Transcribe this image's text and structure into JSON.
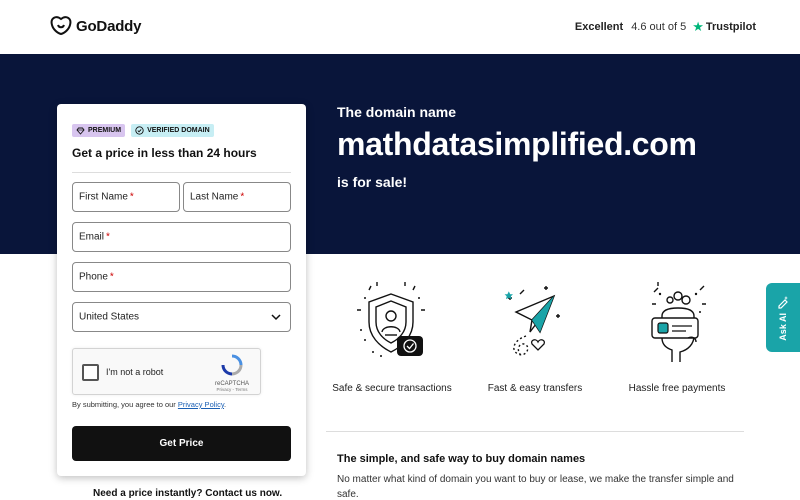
{
  "header": {
    "brand": "GoDaddy",
    "rating_label": "Excellent",
    "rating_score": "4.6 out of 5",
    "rating_source": "Trustpilot"
  },
  "hero": {
    "subtitle": "The domain name",
    "domain": "mathdatasimplified.com",
    "status": "is for sale!"
  },
  "form": {
    "badge_premium": "PREMIUM",
    "badge_verified": "VERIFIED DOMAIN",
    "title": "Get a price in less than 24 hours",
    "first_name_label": "First Name",
    "last_name_label": "Last Name",
    "email_label": "Email",
    "phone_label": "Phone",
    "required_mark": "*",
    "country_value": "United States",
    "captcha_label": "I'm not a robot",
    "captcha_brand": "reCAPTCHA",
    "captcha_links": "Privacy - Terms",
    "consent_text": "By submitting, you agree to our ",
    "consent_link": "Privacy Policy",
    "consent_end": ".",
    "submit_label": "Get Price"
  },
  "instant_price": "Need a price instantly? Contact us now.",
  "features": [
    {
      "label": "Safe & secure transactions",
      "icon": "shield-icon"
    },
    {
      "label": "Fast & easy transfers",
      "icon": "paper-plane-icon"
    },
    {
      "label": "Hassle free payments",
      "icon": "payment-card-icon"
    }
  ],
  "info": {
    "title": "The simple, and safe way to buy domain names",
    "body": "No matter what kind of domain you want to buy or lease, we make the transfer simple and safe."
  },
  "ask_ai": "Ask AI",
  "colors": {
    "hero_bg": "#09153a",
    "button_bg": "#111111",
    "accent_teal": "#1aa4a8",
    "trustpilot_green": "#00b67a",
    "premium_badge": "#d8c5ef",
    "verified_badge": "#c7eef4"
  }
}
